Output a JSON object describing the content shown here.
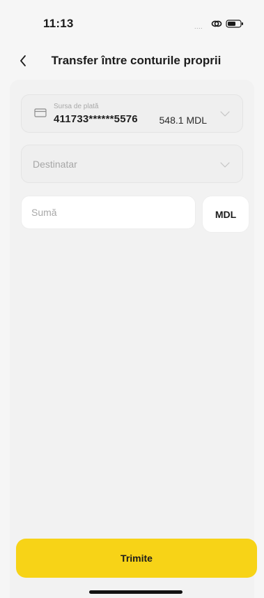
{
  "status_bar": {
    "time": "11:13",
    "signal_dots": "....",
    "icons": [
      "link-icon",
      "battery-icon"
    ]
  },
  "header": {
    "title": "Transfer între conturile proprii",
    "back_icon": "chevron-left-icon"
  },
  "form": {
    "source": {
      "label": "Sursa de plată",
      "card_number": "411733******5576",
      "balance": "548.1 MDL",
      "icon": "credit-card-icon"
    },
    "destination": {
      "placeholder": "Destinatar"
    },
    "amount": {
      "placeholder": "Sumă",
      "value": ""
    },
    "currency": "MDL"
  },
  "actions": {
    "submit_label": "Trimite"
  },
  "colors": {
    "accent": "#f7d317",
    "background": "#f6f6f6",
    "field_background": "#efefef"
  }
}
